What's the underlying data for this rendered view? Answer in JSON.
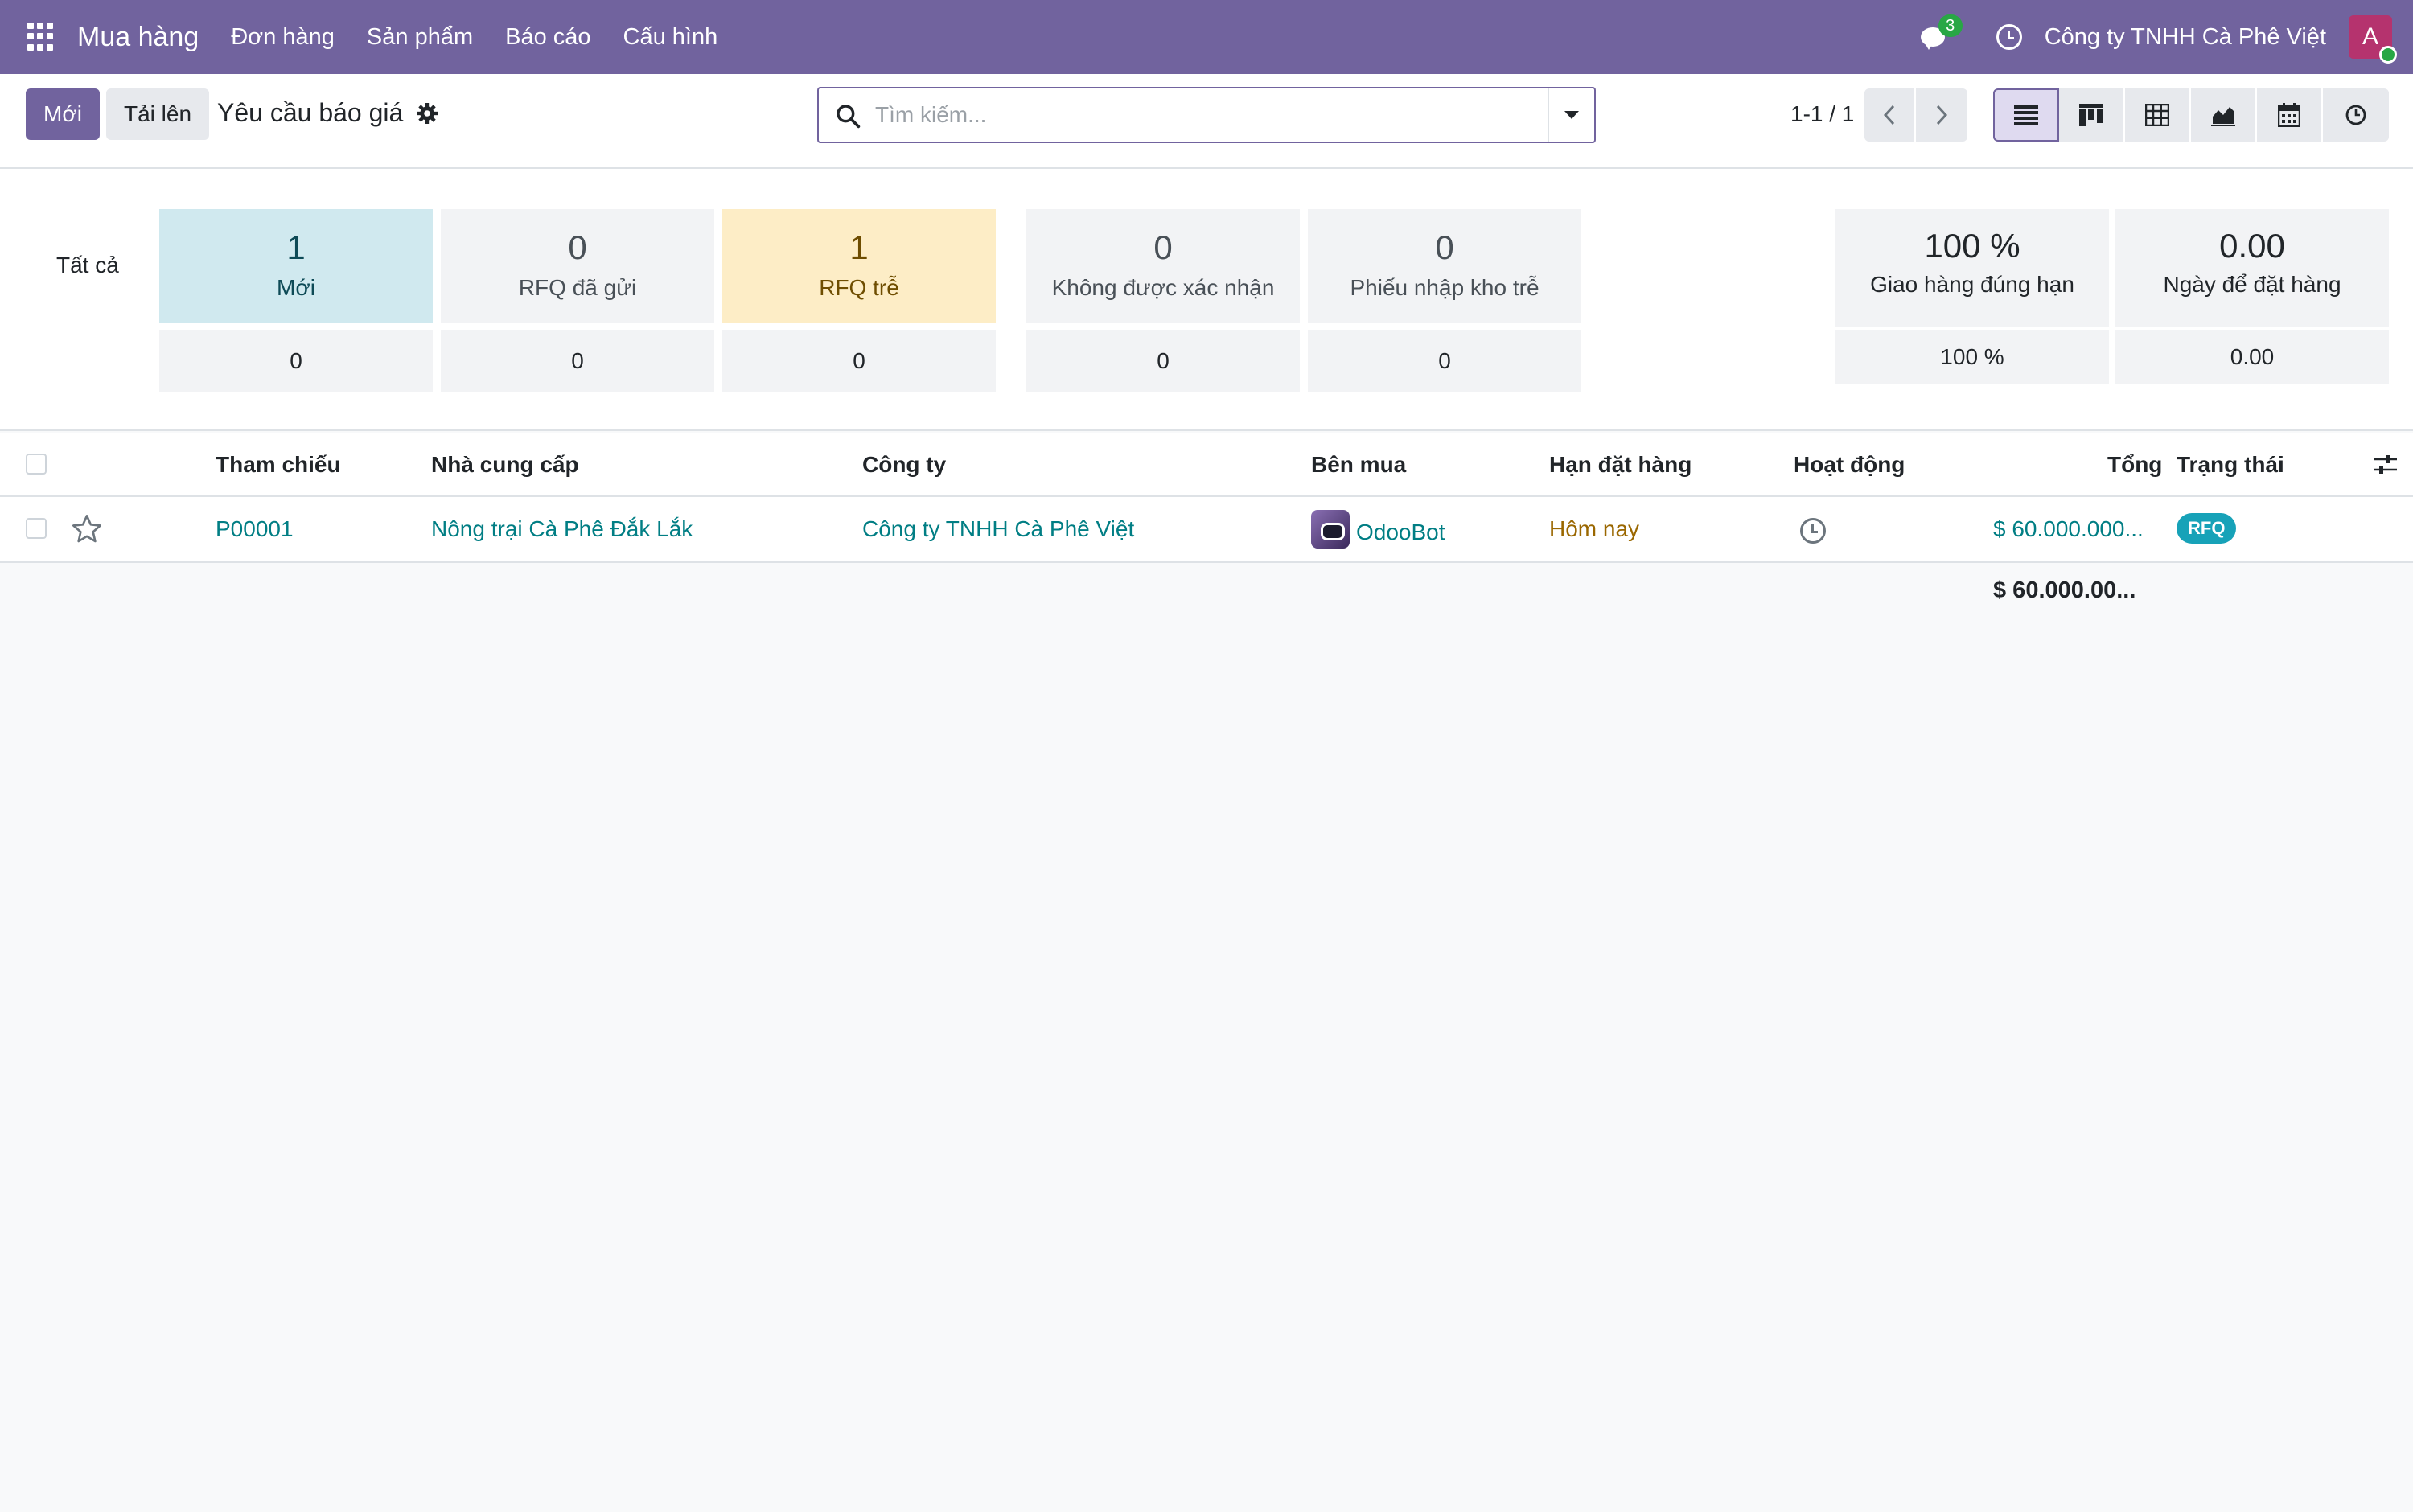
{
  "nav": {
    "brand": "Mua hàng",
    "menu": [
      "Đơn hàng",
      "Sản phẩm",
      "Báo cáo",
      "Cấu hình"
    ],
    "chat_count": "3",
    "company": "Công ty TNHH Cà Phê Việt",
    "avatar_letter": "A"
  },
  "control": {
    "new_label": "Mới",
    "upload_label": "Tải lên",
    "title": "Yêu cầu báo giá",
    "search_placeholder": "Tìm kiếm...",
    "pager": "1-1 / 1"
  },
  "dashboard": {
    "all_label": "Tất cả",
    "tiles": [
      {
        "value": "1",
        "label": "Mới",
        "sub": "0"
      },
      {
        "value": "0",
        "label": "RFQ đã gửi",
        "sub": "0"
      },
      {
        "value": "1",
        "label": "RFQ trễ",
        "sub": "0"
      },
      {
        "value": "0",
        "label": "Không được xác nhận",
        "sub": "0"
      },
      {
        "value": "0",
        "label": "Phiếu nhập kho trễ",
        "sub": "0"
      }
    ],
    "kpis": [
      {
        "value": "100 %",
        "label": "Giao hàng đúng hạn",
        "sub": "100 %"
      },
      {
        "value": "0.00",
        "label": "Ngày để đặt hàng",
        "sub": "0.00"
      }
    ]
  },
  "table": {
    "headers": {
      "ref": "Tham chiếu",
      "vendor": "Nhà cung cấp",
      "company": "Công ty",
      "buyer": "Bên mua",
      "deadline": "Hạn đặt hàng",
      "activity": "Hoạt động",
      "total": "Tổng",
      "status": "Trạng thái"
    },
    "rows": [
      {
        "ref": "P00001",
        "vendor": "Nông trại Cà Phê Đắk Lắk",
        "company": "Công ty TNHH Cà Phê Việt",
        "buyer": "OdooBot",
        "deadline": "Hôm nay",
        "total": "$ 60.000.000...",
        "status": "RFQ"
      }
    ],
    "grand_total": "$ 60.000.00..."
  },
  "colors": {
    "brand": "#71639e",
    "link": "#017e84",
    "status_badge": "#17a2b8",
    "warning": "#9a6700"
  }
}
